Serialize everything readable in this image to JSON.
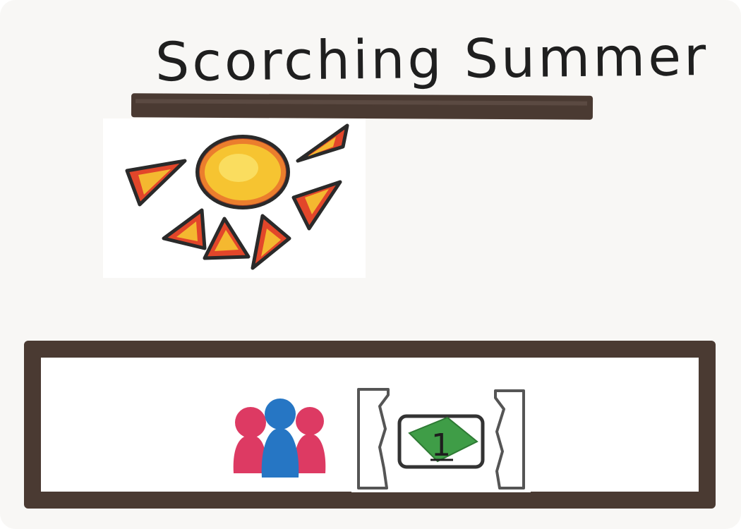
{
  "card": {
    "title": "Scorching Summer",
    "event_icon": "sun-icon",
    "effect": {
      "target_icon": "all-players-icon",
      "reward_icon": "money-card-icon",
      "reward_value": "1",
      "bracket_icon": "bracket-icon"
    },
    "colors": {
      "card_background": "#f8f7f5",
      "frame": "#4a3a32",
      "sun_core": "#f6c431",
      "sun_rays": "#e2462a",
      "player_red": "#dd3a63",
      "player_blue": "#2676c4",
      "money": "#3f9d47"
    }
  }
}
